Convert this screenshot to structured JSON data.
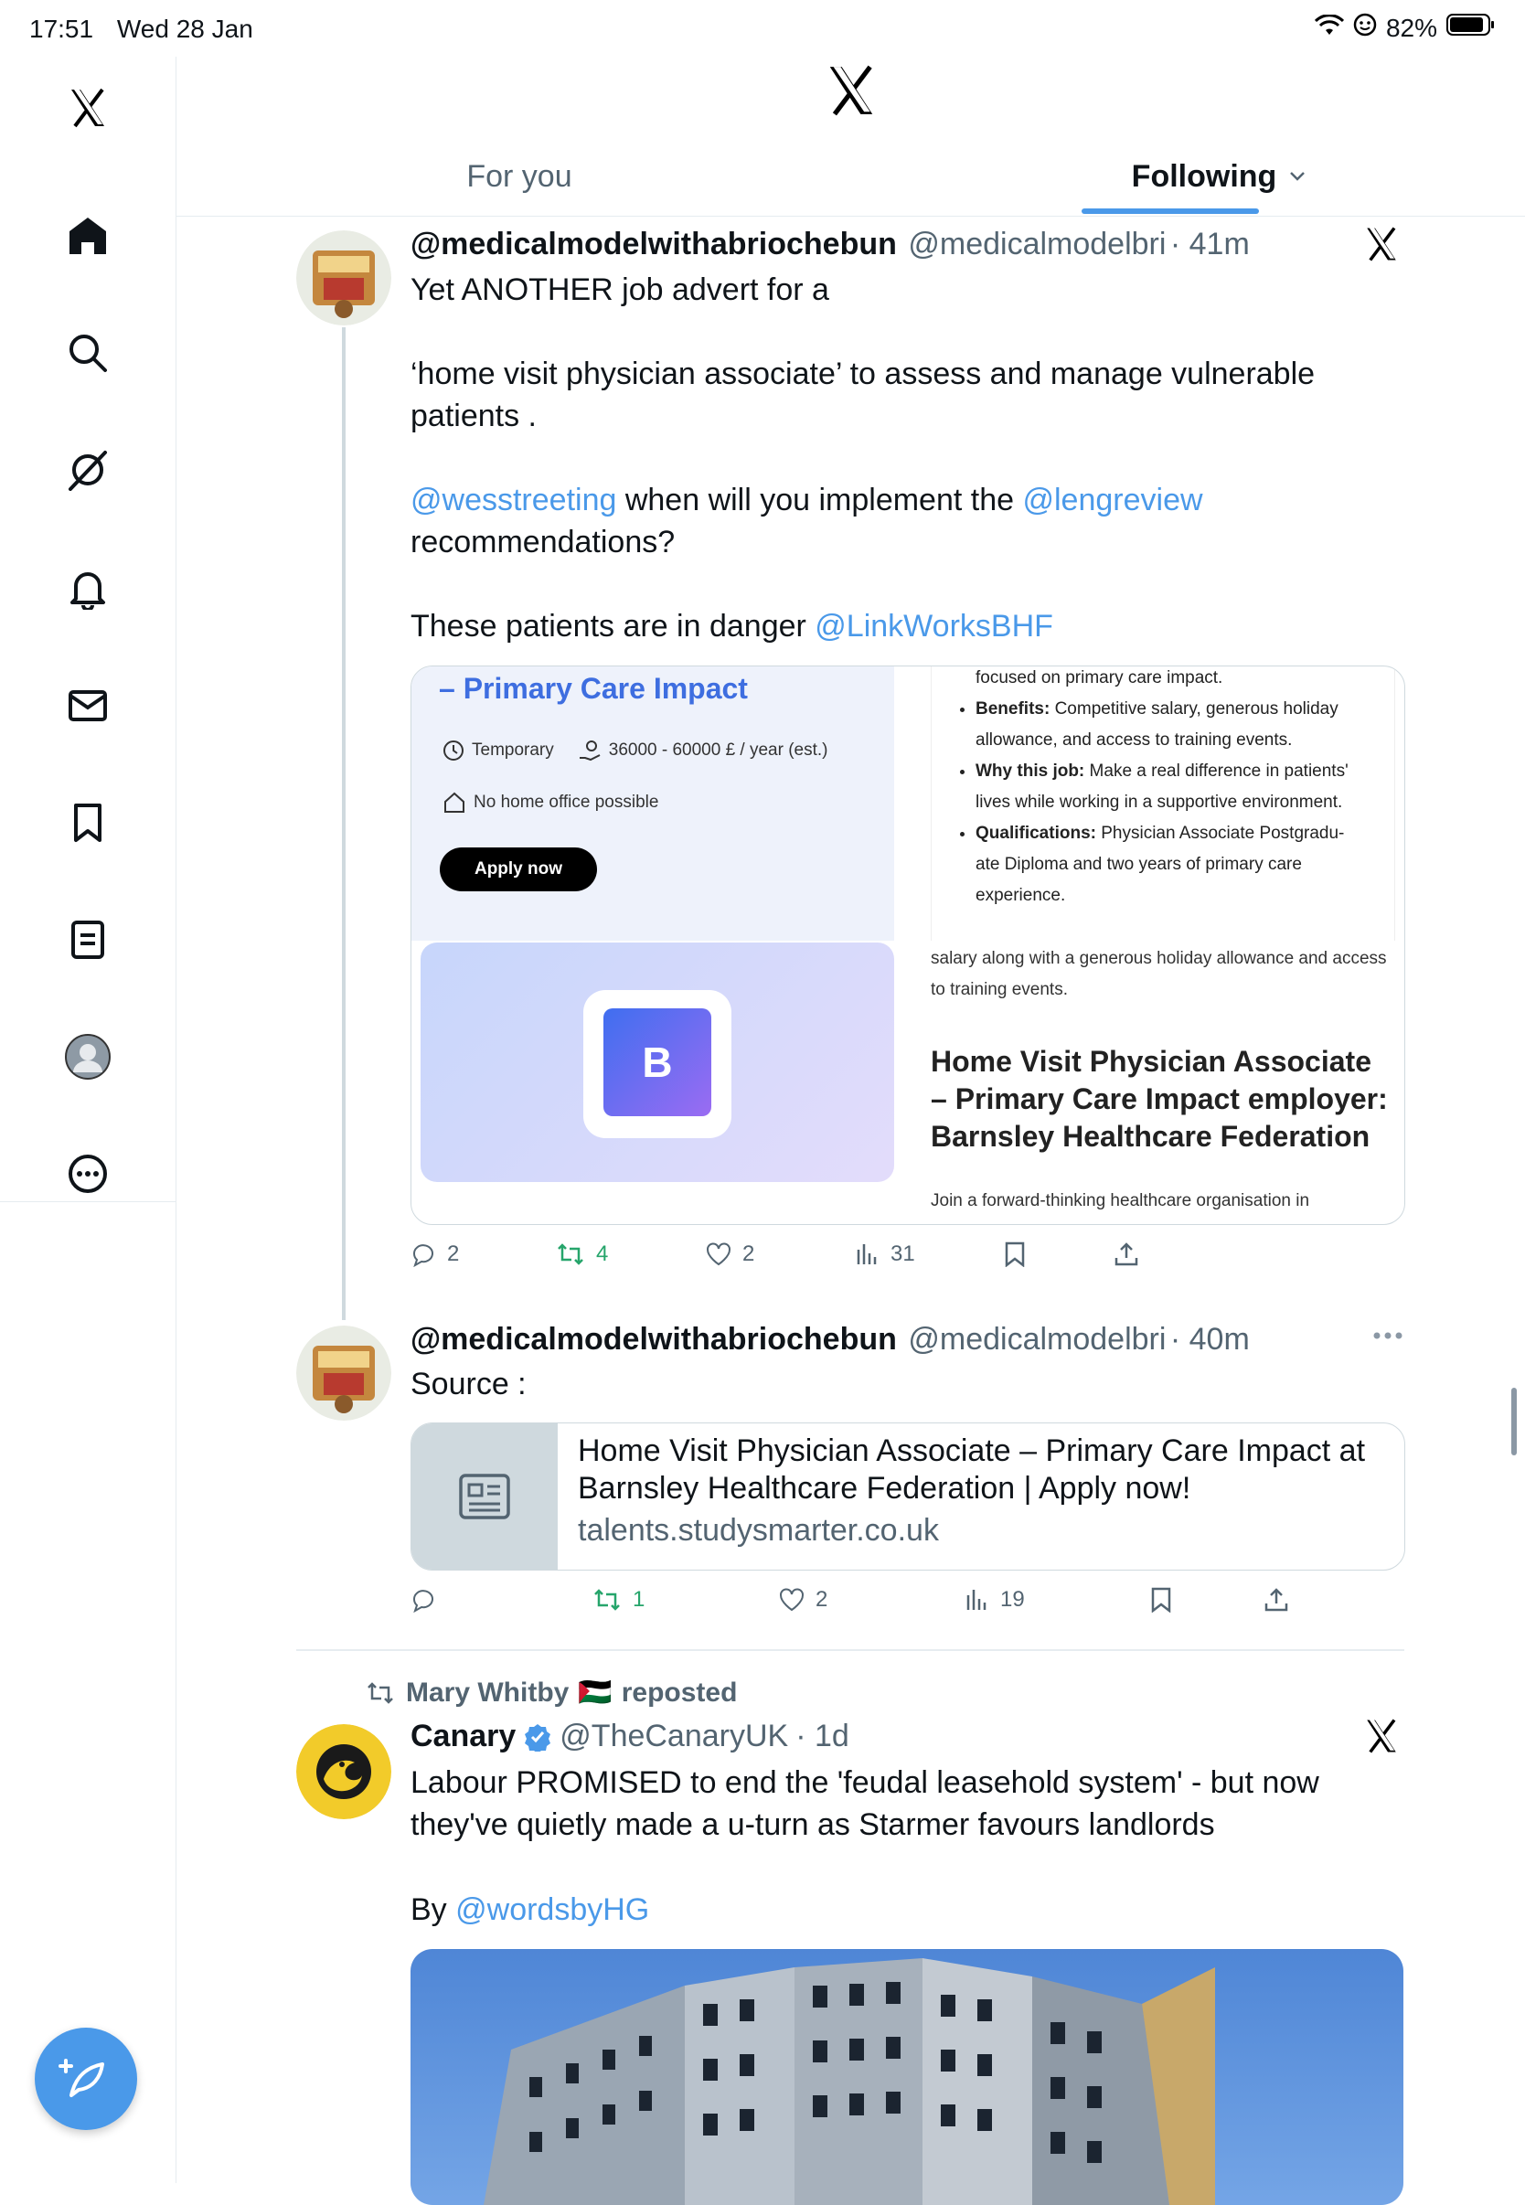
{
  "status_bar": {
    "time": "17:51",
    "date": "Wed 28 Jan",
    "battery": "82%"
  },
  "header": {
    "tabs": [
      {
        "label": "For you"
      },
      {
        "label": "Following"
      }
    ]
  },
  "sidebar": {
    "items": [
      {
        "name": "x-logo-icon"
      },
      {
        "name": "home-icon"
      },
      {
        "name": "search-icon"
      },
      {
        "name": "grok-icon"
      },
      {
        "name": "notifications-icon"
      },
      {
        "name": "messages-icon"
      },
      {
        "name": "bookmarks-icon"
      },
      {
        "name": "lists-icon"
      },
      {
        "name": "profile-icon"
      },
      {
        "name": "more-icon"
      }
    ]
  },
  "tweets": [
    {
      "name": "@medicalmodelwithabriochebun",
      "handle": "@medicalmodelbri",
      "time": "· 41m",
      "text_parts": {
        "line1": "Yet ANOTHER job advert for a",
        "line2": "‘home visit physician associate’ to assess and manage vulnerable patients .",
        "mention1": "@wesstreeting",
        "mid1": " when will you implement the ",
        "mention2": "@lengreview",
        "line3_end": "recommendations?",
        "line4": "These patients are in danger ",
        "mention3": "@LinkWorksBHF"
      },
      "media": {
        "left_heading": "– Primary Care Impact",
        "job_type": "Temporary",
        "salary": "36000 - 60000 £ / year (est.)",
        "remote": "No home office possible",
        "apply": "Apply now",
        "logo_letter": "B",
        "bullets_intro": "focused on primary care impact.",
        "bullet1_label": "Benefits:",
        "bullet1_text": " Competitive salary, generous holiday allowance, and access to training events.",
        "bullet2_label": "Why this job:",
        "bullet2_text": " Make a real difference in patients' lives while working in a supportive environment.",
        "bullet3_label": "Qualifications:",
        "bullet3_text": " Physician Associate Postgradu-ate Diploma and two years of primary care experience.",
        "salary_note": "salary along with a generous holiday allowance and access to training events.",
        "right_heading": "Home Visit Physician Associate – Primary Care Impact employer: Barnsley Healthcare Federation",
        "right_footer": "Join a forward-thinking healthcare organisation in"
      },
      "actions": {
        "replies": "2",
        "reposts": "4",
        "likes": "2",
        "views": "31"
      }
    },
    {
      "name": "@medicalmodelwithabriochebun",
      "handle": "@medicalmodelbri",
      "time": "· 40m",
      "text": "Source :",
      "link_title": "Home Visit Physician Associate – Primary Care Impact at Barnsley Healthcare Federation | Apply now!",
      "link_domain": "talents.studysmarter.co.uk",
      "actions": {
        "replies": "",
        "reposts": "1",
        "likes": "2",
        "views": "19"
      }
    },
    {
      "repost_by": "Mary Whitby",
      "repost_flag": "🇵🇸",
      "repost_label": "reposted",
      "name": "Canary",
      "handle": "@TheCanaryUK",
      "time": "· 1d",
      "text": "Labour PROMISED to end the 'feudal leasehold system' - but now they've quietly made a u-turn as Starmer favours landlords",
      "by_prefix": "By ",
      "by_mention": "@wordsbyHG"
    }
  ],
  "colors": {
    "accent": "#4a99e9",
    "repost_green": "#26a56b",
    "muted": "#536471"
  }
}
